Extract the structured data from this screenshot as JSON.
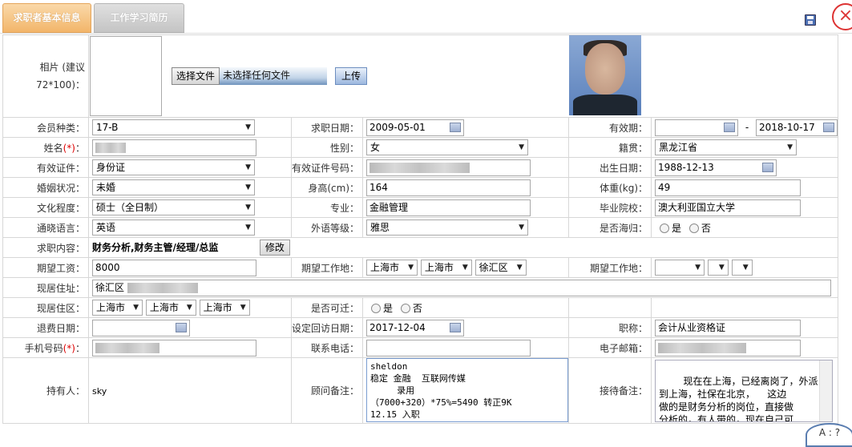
{
  "tabs": [
    {
      "label": "求职者基本信息"
    },
    {
      "label": "工作学习简历"
    }
  ],
  "icons": {
    "save": "save-icon",
    "close": "close-icon"
  },
  "colors": {
    "active_tab": "#f2b56a",
    "inactive_tab": "#c4c4c4",
    "required": "#dd0000",
    "close": "#dd3333"
  },
  "photo": {
    "label": "相片 (建议72*100)：",
    "choose_button": "选择文件",
    "file_status": "未选择任何文件",
    "upload_button": "上传"
  },
  "fields": {
    "member_type": {
      "label": "会员种类：",
      "value": "17-B"
    },
    "apply_date": {
      "label": "求职日期：",
      "value": "2009-05-01"
    },
    "valid_period": {
      "label": "有效期：",
      "from": "",
      "dash": "-",
      "to": "2018-10-17"
    },
    "name": {
      "label": "姓名",
      "req": "(*)",
      "colon": "："
    },
    "gender": {
      "label": "性别：",
      "value": "女"
    },
    "native_place": {
      "label": "籍贯：",
      "value": "黑龙江省"
    },
    "id_type": {
      "label": "有效证件：",
      "value": "身份证"
    },
    "id_number": {
      "label": "有效证件号码："
    },
    "birth_date": {
      "label": "出生日期：",
      "value": "1988-12-13"
    },
    "marital": {
      "label": "婚姻状况：",
      "value": "未婚"
    },
    "height": {
      "label": "身高(cm)：",
      "value": "164"
    },
    "weight": {
      "label": "体重(kg)：",
      "value": "49"
    },
    "education": {
      "label": "文化程度：",
      "value": "硕士（全日制）"
    },
    "major": {
      "label": "专业：",
      "value": "金融管理"
    },
    "school": {
      "label": "毕业院校：",
      "value": "澳大利亚国立大学"
    },
    "language": {
      "label": "通晓语言：",
      "value": "英语"
    },
    "language_level": {
      "label": "外语等级：",
      "value": "雅思"
    },
    "returnee": {
      "label": "是否海归：",
      "yes": "是",
      "no": "否"
    },
    "job_content": {
      "label": "求职内容：",
      "value": "财务分析,财务主管/经理/总监",
      "edit_button": "修改"
    },
    "expected_salary": {
      "label": "期望工资：",
      "value": "8000"
    },
    "expected_location": {
      "label": "期望工作地：",
      "province": "上海市",
      "city": "上海市",
      "district": "徐汇区"
    },
    "expected_location_2": {
      "label": "期望工作地："
    },
    "address": {
      "label": "现居住址：",
      "value": "徐汇区"
    },
    "residence_area": {
      "label": "现居住区：",
      "province": "上海市",
      "city": "上海市",
      "district": "上海市"
    },
    "relocatable": {
      "label": "是否可迁：",
      "yes": "是",
      "no": "否"
    },
    "refund_date": {
      "label": "退费日期："
    },
    "callback_date": {
      "label": "设定回访日期：",
      "value": "2017-12-04"
    },
    "title": {
      "label": "职称：",
      "value": "会计从业资格证"
    },
    "mobile": {
      "label": "手机号码",
      "req": "(*)",
      "colon": "："
    },
    "phone": {
      "label": "联系电话："
    },
    "email": {
      "label": "电子邮箱："
    },
    "owner": {
      "label": "持有人：",
      "value": "sky"
    },
    "consultant_note": {
      "label": "顾问备注：",
      "value": "sheldon\n稳定 金融  互联网传媒\n     录用\n（7000+320）*75%=5490 转正9K\n12.15 入职"
    },
    "reception_note": {
      "label": "接待备注：",
      "value": "现在在上海，已经离岗了，外派\n到上海，社保在北京，    这边\n做的是财务分析的岗位，直接做\n分析的，有人带的，现在自己可\n以独立做了，薪资8K，基本的全"
    }
  },
  "corner_widget": {
    "text": "A : ?"
  }
}
